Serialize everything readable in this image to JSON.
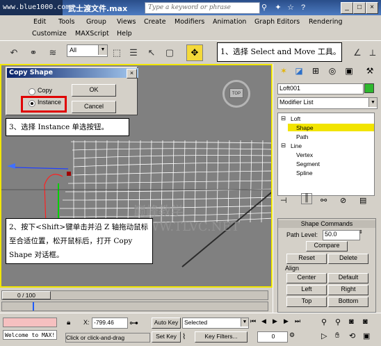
{
  "titlebar": {
    "watermark": "www.blue1000.com",
    "title": "武士渡文件.max",
    "search_placeholder": "Type a keyword or phrase"
  },
  "menu": {
    "row1": [
      "Edit",
      "Tools",
      "Group",
      "Views",
      "Create",
      "Modifiers",
      "Animation",
      "Graph Editors",
      "Rendering"
    ],
    "row2": [
      "Customize",
      "MAXScript",
      "Help"
    ]
  },
  "toolbar": {
    "filter_value": "All"
  },
  "callouts": {
    "step1": "1、选择 Select and Move 工具。",
    "step2": "2、按下<Shift>键单击并沿 Z 轴拖动鼠标至合适位置，松开鼠标后，打开 Copy Shape 对话框。",
    "step3": "3、选择 Instance 单选按钮。"
  },
  "dialog": {
    "title": "Copy Shape",
    "copy_label": "Copy",
    "instance_label": "Instance",
    "ok_label": "OK",
    "cancel_label": "Cancel",
    "close_glyph": "×"
  },
  "viewport": {
    "viewcube_label": "TOP",
    "watermark": "巅峰教学WWW.TLVC.NET"
  },
  "command_panel": {
    "object_name": "Loft001",
    "modifier_list": "Modifier List",
    "stack": [
      {
        "label": "Loft",
        "level": 0,
        "expander": "⊟"
      },
      {
        "label": "Shape",
        "level": 1,
        "selected": true
      },
      {
        "label": "Path",
        "level": 1
      },
      {
        "label": "Line",
        "level": 0,
        "expander": "⊟"
      },
      {
        "label": "Vertex",
        "level": 1
      },
      {
        "label": "Segment",
        "level": 1
      },
      {
        "label": "Spline",
        "level": 1
      }
    ],
    "rollout_title": "Shape Commands",
    "path_level_label": "Path Level:",
    "path_level_value": "50.0",
    "compare_label": "Compare",
    "reset_label": "Reset",
    "delete_label": "Delete",
    "align_label": "Align",
    "center_label": "Center",
    "default_label": "Default",
    "left_label": "Left",
    "right_label": "Right",
    "top_label": "Top",
    "bottom_label": "Bottom"
  },
  "timeline": {
    "frame_counter": "0 / 100"
  },
  "status": {
    "maxscript_prompt": "Welcome to MAX!",
    "x_label": "X:",
    "x_value": "-799.46",
    "prompt_text": "Click or click-and-drag",
    "auto_key": "Auto Key",
    "set_key": "Set Key",
    "selected": "Selected",
    "key_filters": "Key Filters...",
    "frame_value": "0"
  }
}
